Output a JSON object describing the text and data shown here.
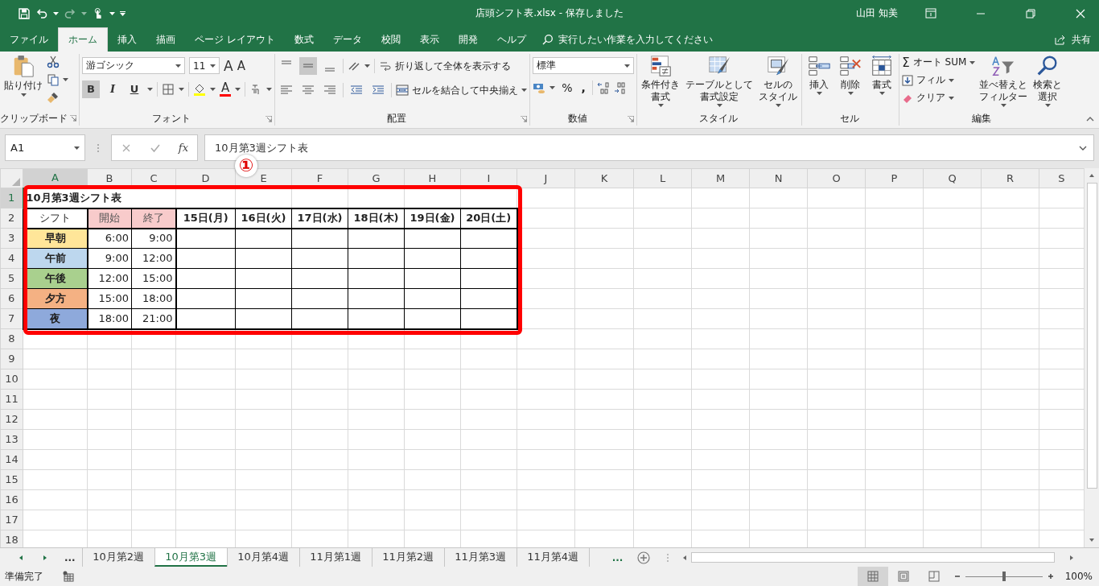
{
  "window": {
    "title": "店頭シフト表.xlsx  -  保存しました",
    "user": "山田 知美"
  },
  "ribbon_tabs": [
    {
      "label": "ファイル",
      "selected": false
    },
    {
      "label": "ホーム",
      "selected": true
    },
    {
      "label": "挿入",
      "selected": false
    },
    {
      "label": "描画",
      "selected": false
    },
    {
      "label": "ページ レイアウト",
      "selected": false
    },
    {
      "label": "数式",
      "selected": false
    },
    {
      "label": "データ",
      "selected": false
    },
    {
      "label": "校閲",
      "selected": false
    },
    {
      "label": "表示",
      "selected": false
    },
    {
      "label": "開発",
      "selected": false
    },
    {
      "label": "ヘルプ",
      "selected": false
    }
  ],
  "tell_me": {
    "placeholder": "実行したい作業を入力してください"
  },
  "share": "共有",
  "clipboard": {
    "paste": "貼り付け",
    "label": "クリップボード"
  },
  "font": {
    "name": "游ゴシック",
    "size": "11",
    "grow": "A",
    "shrink": "A",
    "color_label": "A",
    "label": "フォント",
    "styles": [
      {
        "label": "B",
        "selected": true
      },
      {
        "label": "I",
        "selected": false
      },
      {
        "label": "U",
        "selected": false
      }
    ]
  },
  "alignment": {
    "wrap": "折り返して全体を表示する",
    "merge": "セルを結合して中央揃え",
    "label": "配置",
    "vertical": [
      {
        "selected": false
      },
      {
        "selected": true
      },
      {
        "selected": false
      }
    ]
  },
  "number": {
    "format": "標準",
    "percent": "%",
    "comma": ",",
    "label": "数値"
  },
  "styles": {
    "buttons": [
      {
        "lines": [
          "条件付き",
          "書式"
        ]
      },
      {
        "lines": [
          "テーブルとして",
          "書式設定"
        ]
      },
      {
        "lines": [
          "セルの",
          "スタイル"
        ]
      }
    ],
    "label": "スタイル"
  },
  "cells": {
    "buttons": [
      "挿入",
      "削除",
      "書式"
    ],
    "label": "セル"
  },
  "editing": {
    "sum_symbol": "Σ",
    "autosum": "オート SUM",
    "fill": "フィル",
    "clear": "クリア",
    "sort": {
      "lines": [
        "並べ替えと",
        "フィルター"
      ]
    },
    "find": {
      "lines": [
        "検索と",
        "選択"
      ]
    },
    "label": "編集"
  },
  "formula_bar": {
    "name_box": "A1",
    "fx": "fx",
    "content": "10月第3週シフト表"
  },
  "sheet": {
    "title": "10月第3週シフト表",
    "columns": [
      {
        "label": "A",
        "selected": true
      },
      {
        "label": "B",
        "selected": false
      },
      {
        "label": "C",
        "selected": false
      },
      {
        "label": "D",
        "selected": false
      },
      {
        "label": "E",
        "selected": false
      },
      {
        "label": "F",
        "selected": false
      },
      {
        "label": "G",
        "selected": false
      },
      {
        "label": "H",
        "selected": false
      },
      {
        "label": "I",
        "selected": false
      },
      {
        "label": "J",
        "selected": false
      },
      {
        "label": "K",
        "selected": false
      },
      {
        "label": "L",
        "selected": false
      },
      {
        "label": "M",
        "selected": false
      },
      {
        "label": "N",
        "selected": false
      },
      {
        "label": "O",
        "selected": false
      },
      {
        "label": "P",
        "selected": false
      },
      {
        "label": "Q",
        "selected": false
      },
      {
        "label": "R",
        "selected": false
      },
      {
        "label": "S",
        "selected": false
      }
    ],
    "rows": [
      {
        "label": "1",
        "selected": true
      },
      {
        "label": "2",
        "selected": false
      },
      {
        "label": "3",
        "selected": false
      },
      {
        "label": "4",
        "selected": false
      },
      {
        "label": "5",
        "selected": false
      },
      {
        "label": "6",
        "selected": false
      },
      {
        "label": "7",
        "selected": false
      },
      {
        "label": "8",
        "selected": false
      },
      {
        "label": "9",
        "selected": false
      },
      {
        "label": "10",
        "selected": false
      },
      {
        "label": "11",
        "selected": false
      },
      {
        "label": "12",
        "selected": false
      },
      {
        "label": "13",
        "selected": false
      },
      {
        "label": "14",
        "selected": false
      },
      {
        "label": "15",
        "selected": false
      },
      {
        "label": "16",
        "selected": false
      },
      {
        "label": "17",
        "selected": false
      },
      {
        "label": "18",
        "selected": false
      }
    ],
    "header": [
      {
        "text": "シフト",
        "kind": "plain"
      },
      {
        "text": "開始",
        "kind": "time"
      },
      {
        "text": "終了",
        "kind": "time"
      },
      {
        "text": "15日(月)",
        "kind": "day"
      },
      {
        "text": "16日(火)",
        "kind": "day"
      },
      {
        "text": "17日(水)",
        "kind": "day"
      },
      {
        "text": "18日(木)",
        "kind": "day"
      },
      {
        "text": "19日(金)",
        "kind": "day"
      },
      {
        "text": "20日(土)",
        "kind": "day"
      }
    ],
    "shifts": [
      {
        "name": "早朝",
        "color": "#ffe699",
        "start": "6:00",
        "end": "9:00"
      },
      {
        "name": "午前",
        "color": "#bdd7ee",
        "start": "9:00",
        "end": "12:00"
      },
      {
        "name": "午後",
        "color": "#a9d08e",
        "start": "12:00",
        "end": "15:00"
      },
      {
        "name": "夕方",
        "color": "#f4b183",
        "start": "15:00",
        "end": "18:00"
      },
      {
        "name": "夜",
        "color": "#8ea9db",
        "start": "18:00",
        "end": "21:00"
      }
    ]
  },
  "callout": {
    "label": "①"
  },
  "sheet_nav": {
    "left_more": "...",
    "right_more": "..."
  },
  "sheet_tabs": [
    {
      "label": "10月第2週",
      "selected": false
    },
    {
      "label": "10月第3週",
      "selected": true
    },
    {
      "label": "10月第4週",
      "selected": false
    },
    {
      "label": "11月第1週",
      "selected": false
    },
    {
      "label": "11月第2週",
      "selected": false
    },
    {
      "label": "11月第3週",
      "selected": false
    },
    {
      "label": "11月第4週",
      "selected": false
    }
  ],
  "status": {
    "text": "準備完了",
    "zoom": "100%"
  },
  "zoom_slider": {
    "level": 0.5
  }
}
